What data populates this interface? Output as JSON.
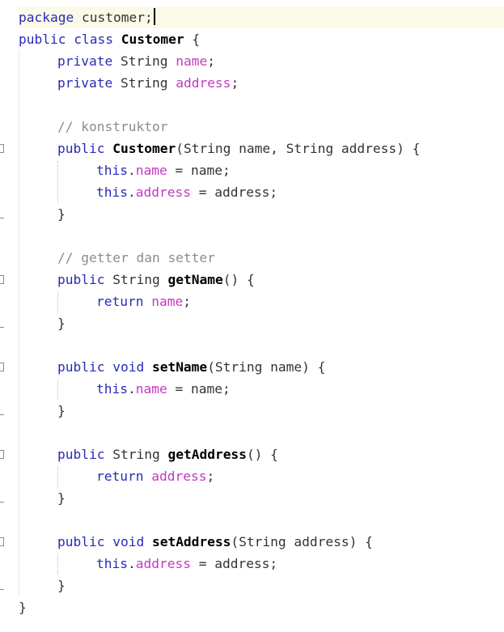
{
  "editor": {
    "language": "java",
    "colors": {
      "keyword": "#2a2ab8",
      "field": "#c338c3",
      "comment": "#8c8c8c",
      "current_line": "#fbf9e8"
    },
    "lines": [
      {
        "indent": 0,
        "current": true,
        "tokens": [
          [
            "kw",
            "package"
          ],
          [
            "p",
            " customer;"
          ]
        ]
      },
      {
        "indent": 0,
        "tokens": [
          [
            "kw",
            "public class "
          ],
          [
            "b",
            "Customer"
          ],
          [
            "p",
            " {"
          ]
        ]
      },
      {
        "indent": 1,
        "tokens": [
          [
            "kw",
            "private "
          ],
          [
            "p",
            "String "
          ],
          [
            "fld",
            "name"
          ],
          [
            "p",
            ";"
          ]
        ]
      },
      {
        "indent": 1,
        "tokens": [
          [
            "kw",
            "private "
          ],
          [
            "p",
            "String "
          ],
          [
            "fld",
            "address"
          ],
          [
            "p",
            ";"
          ]
        ]
      },
      {
        "indent": 0,
        "tokens": []
      },
      {
        "indent": 1,
        "tokens": [
          [
            "cmt",
            "// konstruktor"
          ]
        ]
      },
      {
        "indent": 1,
        "fold": "open",
        "tokens": [
          [
            "kw",
            "public "
          ],
          [
            "b",
            "Customer"
          ],
          [
            "p",
            "(String name, String address) {"
          ]
        ]
      },
      {
        "indent": 2,
        "tokens": [
          [
            "kw",
            "this"
          ],
          [
            "p",
            "."
          ],
          [
            "fld",
            "name"
          ],
          [
            "p",
            " = name;"
          ]
        ]
      },
      {
        "indent": 2,
        "tokens": [
          [
            "kw",
            "this"
          ],
          [
            "p",
            "."
          ],
          [
            "fld",
            "address"
          ],
          [
            "p",
            " = address;"
          ]
        ]
      },
      {
        "indent": 1,
        "fold": "close",
        "tokens": [
          [
            "p",
            "}"
          ]
        ]
      },
      {
        "indent": 0,
        "tokens": []
      },
      {
        "indent": 1,
        "tokens": [
          [
            "cmt",
            "// getter dan setter"
          ]
        ]
      },
      {
        "indent": 1,
        "fold": "open",
        "tokens": [
          [
            "kw",
            "public "
          ],
          [
            "p",
            "String "
          ],
          [
            "b",
            "getName"
          ],
          [
            "p",
            "() {"
          ]
        ]
      },
      {
        "indent": 2,
        "tokens": [
          [
            "kw",
            "return "
          ],
          [
            "fld",
            "name"
          ],
          [
            "p",
            ";"
          ]
        ]
      },
      {
        "indent": 1,
        "fold": "close",
        "tokens": [
          [
            "p",
            "}"
          ]
        ]
      },
      {
        "indent": 0,
        "tokens": []
      },
      {
        "indent": 1,
        "fold": "open",
        "tokens": [
          [
            "kw",
            "public void "
          ],
          [
            "b",
            "setName"
          ],
          [
            "p",
            "(String name) {"
          ]
        ]
      },
      {
        "indent": 2,
        "tokens": [
          [
            "kw",
            "this"
          ],
          [
            "p",
            "."
          ],
          [
            "fld",
            "name"
          ],
          [
            "p",
            " = name;"
          ]
        ]
      },
      {
        "indent": 1,
        "fold": "close",
        "tokens": [
          [
            "p",
            "}"
          ]
        ]
      },
      {
        "indent": 0,
        "tokens": []
      },
      {
        "indent": 1,
        "fold": "open",
        "tokens": [
          [
            "kw",
            "public "
          ],
          [
            "p",
            "String "
          ],
          [
            "b",
            "getAddress"
          ],
          [
            "p",
            "() {"
          ]
        ]
      },
      {
        "indent": 2,
        "tokens": [
          [
            "kw",
            "return "
          ],
          [
            "fld",
            "address"
          ],
          [
            "p",
            ";"
          ]
        ]
      },
      {
        "indent": 1,
        "fold": "close",
        "tokens": [
          [
            "p",
            "}"
          ]
        ]
      },
      {
        "indent": 0,
        "tokens": []
      },
      {
        "indent": 1,
        "fold": "open",
        "tokens": [
          [
            "kw",
            "public void "
          ],
          [
            "b",
            "setAddress"
          ],
          [
            "p",
            "(String address) {"
          ]
        ]
      },
      {
        "indent": 2,
        "tokens": [
          [
            "kw",
            "this"
          ],
          [
            "p",
            "."
          ],
          [
            "fld",
            "address"
          ],
          [
            "p",
            " = address;"
          ]
        ]
      },
      {
        "indent": 1,
        "fold": "close",
        "tokens": [
          [
            "p",
            "}"
          ]
        ]
      },
      {
        "indent": 0,
        "tokens": [
          [
            "p",
            "}"
          ]
        ]
      }
    ]
  }
}
